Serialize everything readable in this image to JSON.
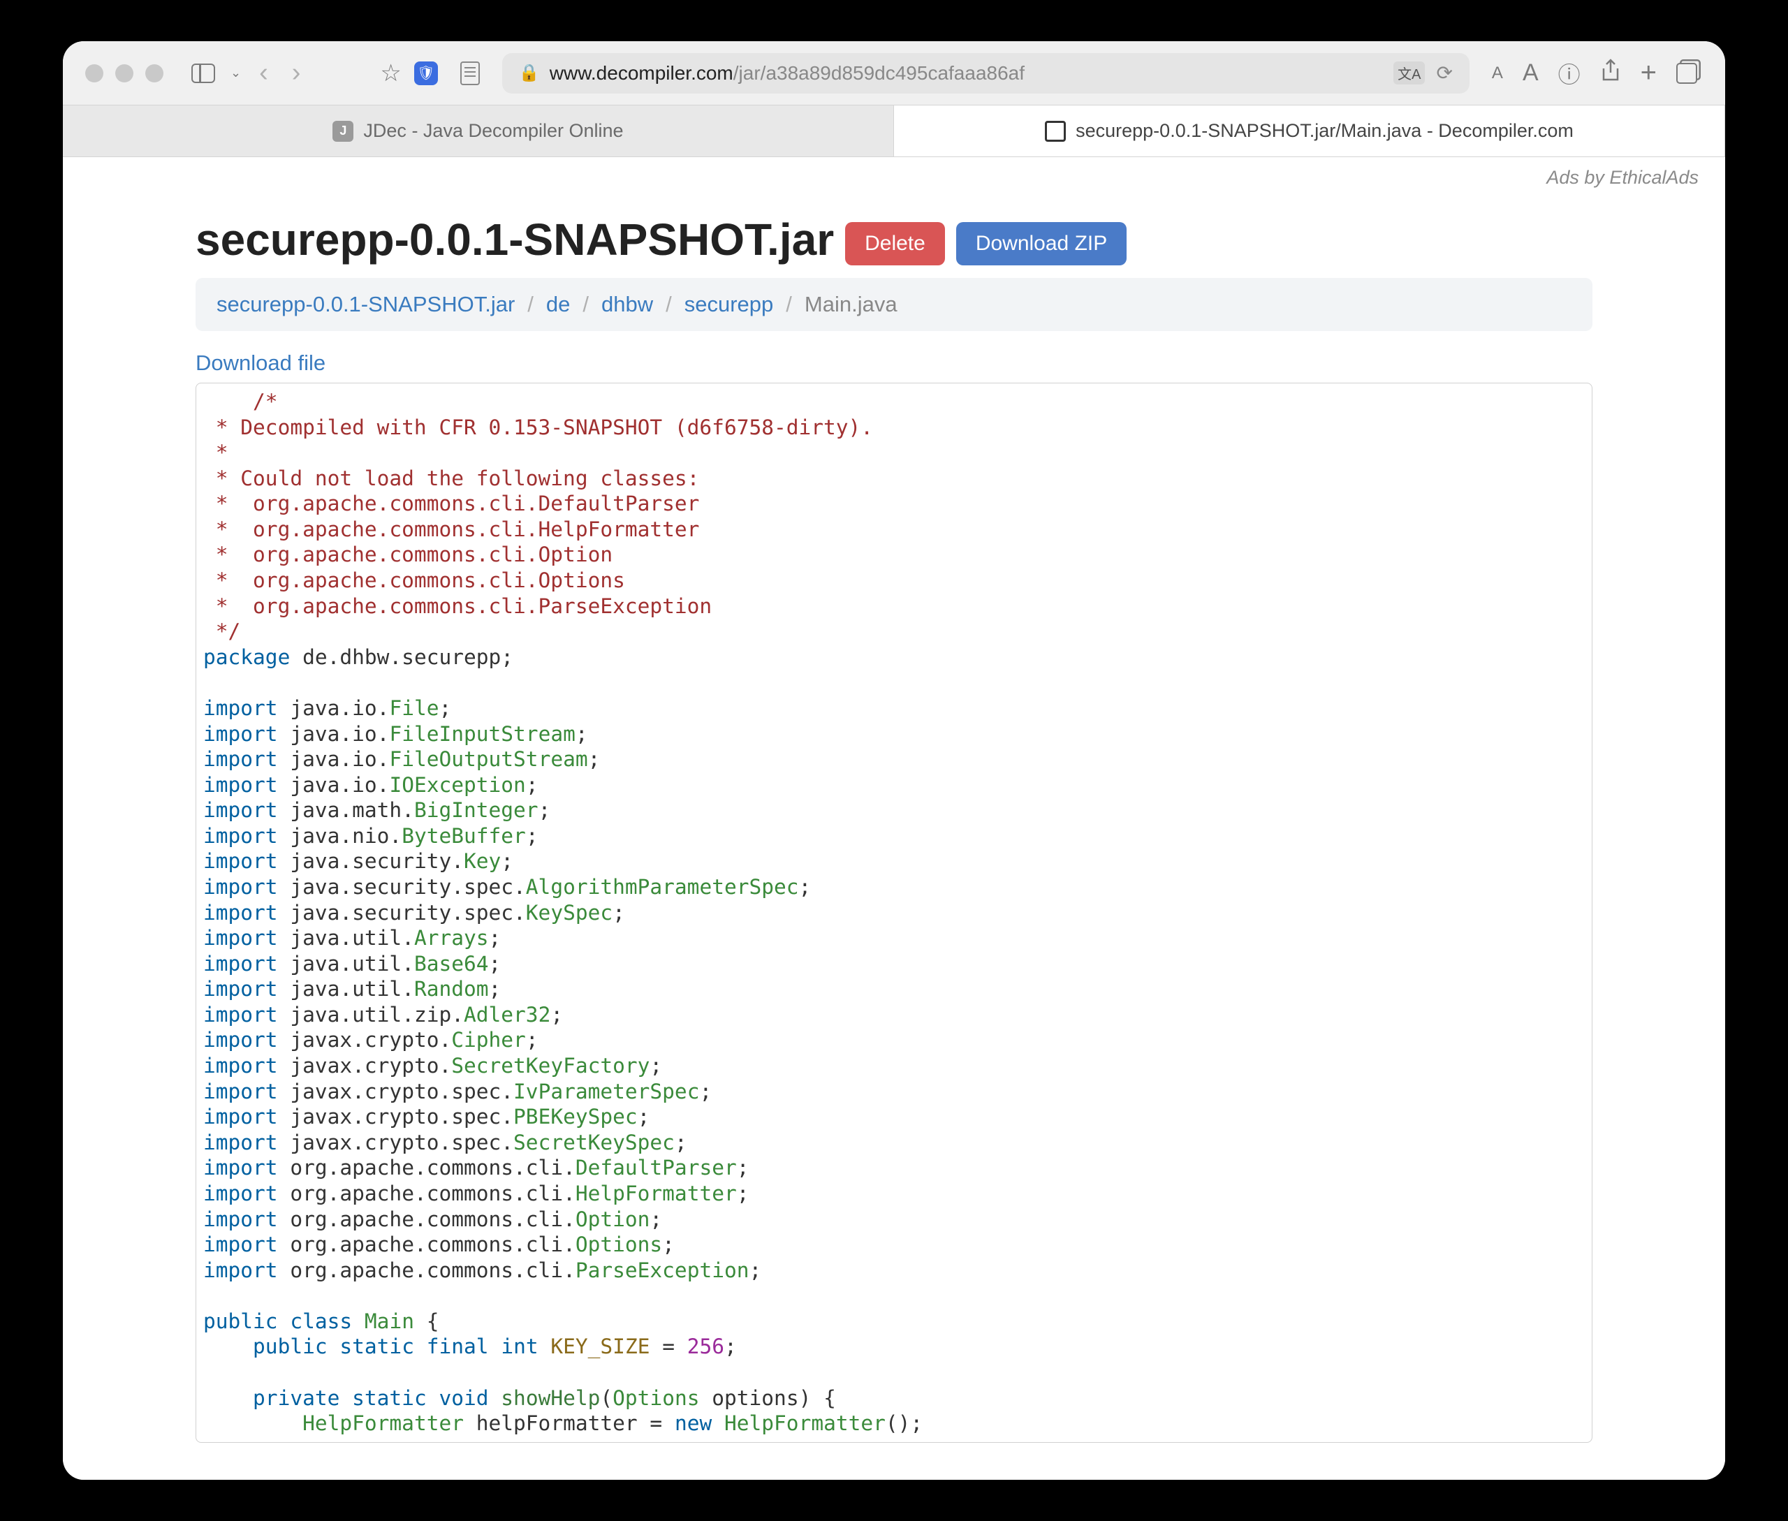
{
  "toolbar": {
    "url_domain": "www.decompiler.com",
    "url_path": "/jar/a38a89d859dc495cafaaa86af"
  },
  "tabs": [
    {
      "label": "JDec - Java Decompiler Online",
      "favicon": "J",
      "active": false
    },
    {
      "label": "securepp-0.0.1-SNAPSHOT.jar/Main.java - Decompiler.com",
      "favicon": "",
      "active": true
    }
  ],
  "ads_text": "Ads by EthicalAds",
  "page": {
    "title": "securepp-0.0.1-SNAPSHOT.jar",
    "delete_label": "Delete",
    "download_zip_label": "Download ZIP"
  },
  "breadcrumb": [
    "securepp-0.0.1-SNAPSHOT.jar",
    "de",
    "dhbw",
    "securepp",
    "Main.java"
  ],
  "download_file_label": "Download file",
  "code": {
    "comment_lines": [
      "    /*",
      " * Decompiled with CFR 0.153-SNAPSHOT (d6f6758-dirty).",
      " * ",
      " * Could not load the following classes:",
      " *  org.apache.commons.cli.DefaultParser",
      " *  org.apache.commons.cli.HelpFormatter",
      " *  org.apache.commons.cli.Option",
      " *  org.apache.commons.cli.Options",
      " *  org.apache.commons.cli.ParseException",
      " */"
    ],
    "package": "de.dhbw.securepp",
    "imports": [
      [
        "java",
        "io",
        "File"
      ],
      [
        "java",
        "io",
        "FileInputStream"
      ],
      [
        "java",
        "io",
        "FileOutputStream"
      ],
      [
        "java",
        "io",
        "IOException"
      ],
      [
        "java",
        "math",
        "BigInteger"
      ],
      [
        "java",
        "nio",
        "ByteBuffer"
      ],
      [
        "java",
        "security",
        "Key"
      ],
      [
        "java",
        "security",
        "spec",
        "AlgorithmParameterSpec"
      ],
      [
        "java",
        "security",
        "spec",
        "KeySpec"
      ],
      [
        "java",
        "util",
        "Arrays"
      ],
      [
        "java",
        "util",
        "Base64"
      ],
      [
        "java",
        "util",
        "Random"
      ],
      [
        "java",
        "util",
        "zip",
        "Adler32"
      ],
      [
        "javax",
        "crypto",
        "Cipher"
      ],
      [
        "javax",
        "crypto",
        "SecretKeyFactory"
      ],
      [
        "javax",
        "crypto",
        "spec",
        "IvParameterSpec"
      ],
      [
        "javax",
        "crypto",
        "spec",
        "PBEKeySpec"
      ],
      [
        "javax",
        "crypto",
        "spec",
        "SecretKeySpec"
      ],
      [
        "org",
        "apache",
        "commons",
        "cli",
        "DefaultParser"
      ],
      [
        "org",
        "apache",
        "commons",
        "cli",
        "HelpFormatter"
      ],
      [
        "org",
        "apache",
        "commons",
        "cli",
        "Option"
      ],
      [
        "org",
        "apache",
        "commons",
        "cli",
        "Options"
      ],
      [
        "org",
        "apache",
        "commons",
        "cli",
        "ParseException"
      ]
    ],
    "class_name": "Main",
    "const_name": "KEY_SIZE",
    "const_value": "256",
    "method": {
      "name": "showHelp",
      "param_type": "Options",
      "param_name": "options",
      "local_type": "HelpFormatter",
      "local_name": "helpFormatter",
      "ctor_type": "HelpFormatter"
    }
  }
}
